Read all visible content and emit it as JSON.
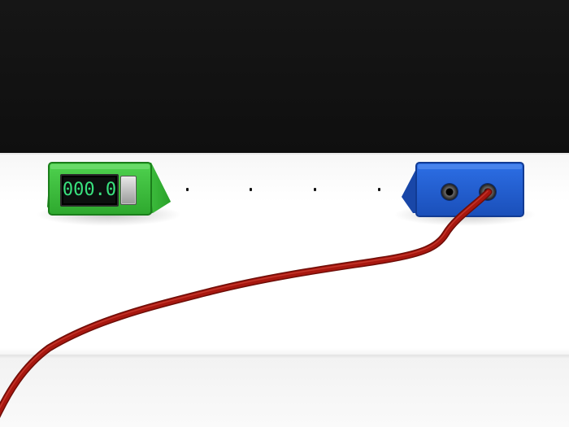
{
  "scene": {
    "colors": {
      "background": "#121212",
      "bench": "#ffffff",
      "meter_body": "#3cc43c",
      "source_body": "#1e5ad2",
      "wire": "#a11a12",
      "display_text": "#39e27e"
    }
  },
  "meter": {
    "reading": "000.0",
    "switch_icon": "toggle-switch"
  },
  "connection_points": [
    "dot",
    "dot",
    "dot",
    "dot"
  ],
  "source": {
    "terminals": [
      "jack",
      "jack"
    ]
  },
  "wire": {
    "color_name": "red"
  }
}
